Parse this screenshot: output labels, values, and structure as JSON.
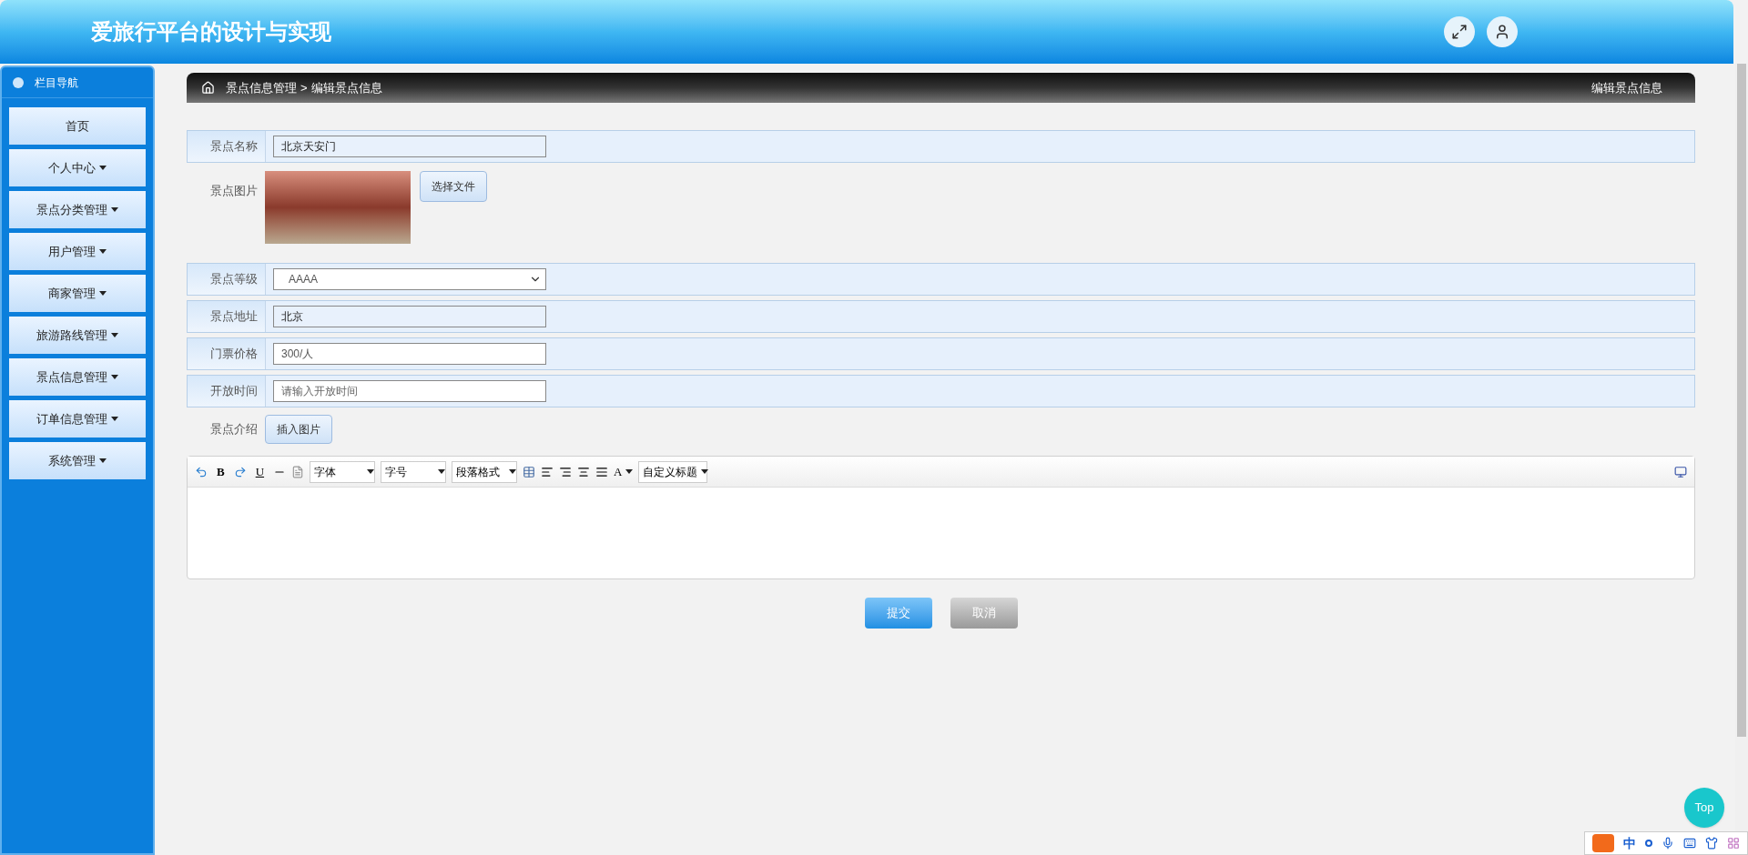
{
  "header": {
    "title": "爱旅行平台的设计与实现"
  },
  "sidebar": {
    "title": "栏目导航",
    "items": [
      {
        "label": "首页",
        "has_menu": false
      },
      {
        "label": "个人中心",
        "has_menu": true
      },
      {
        "label": "景点分类管理",
        "has_menu": true
      },
      {
        "label": "用户管理",
        "has_menu": true
      },
      {
        "label": "商家管理",
        "has_menu": true
      },
      {
        "label": "旅游路线管理",
        "has_menu": true
      },
      {
        "label": "景点信息管理",
        "has_menu": true
      },
      {
        "label": "订单信息管理",
        "has_menu": true
      },
      {
        "label": "系统管理",
        "has_menu": true
      }
    ]
  },
  "breadcrumb": {
    "parent": "景点信息管理",
    "separator": ">",
    "current": "编辑景点信息",
    "page_title": "编辑景点信息"
  },
  "form": {
    "fields": [
      {
        "kind": "text",
        "label": "景点名称",
        "value": "北京天安门",
        "readonly": true
      },
      {
        "kind": "image",
        "label": "景点图片",
        "button": "选择文件"
      },
      {
        "kind": "select",
        "label": "景点等级",
        "value": "AAAA"
      },
      {
        "kind": "text",
        "label": "景点地址",
        "value": "北京",
        "readonly": true
      },
      {
        "kind": "text",
        "label": "门票价格",
        "value": "300/人",
        "readonly": false
      },
      {
        "kind": "text",
        "label": "开放时间",
        "placeholder": "请输入开放时间",
        "readonly": false
      },
      {
        "kind": "editor",
        "label": "景点介绍",
        "button": "插入图片"
      }
    ]
  },
  "editor": {
    "bold": "B",
    "underline": "U",
    "font_color": "A",
    "selects": [
      "字体",
      "字号",
      "段落格式"
    ],
    "heading_select": "自定义标题"
  },
  "actions": {
    "submit": "提交",
    "cancel": "取消"
  },
  "top_button": "Top",
  "ime_bar": {
    "mode": "中"
  }
}
